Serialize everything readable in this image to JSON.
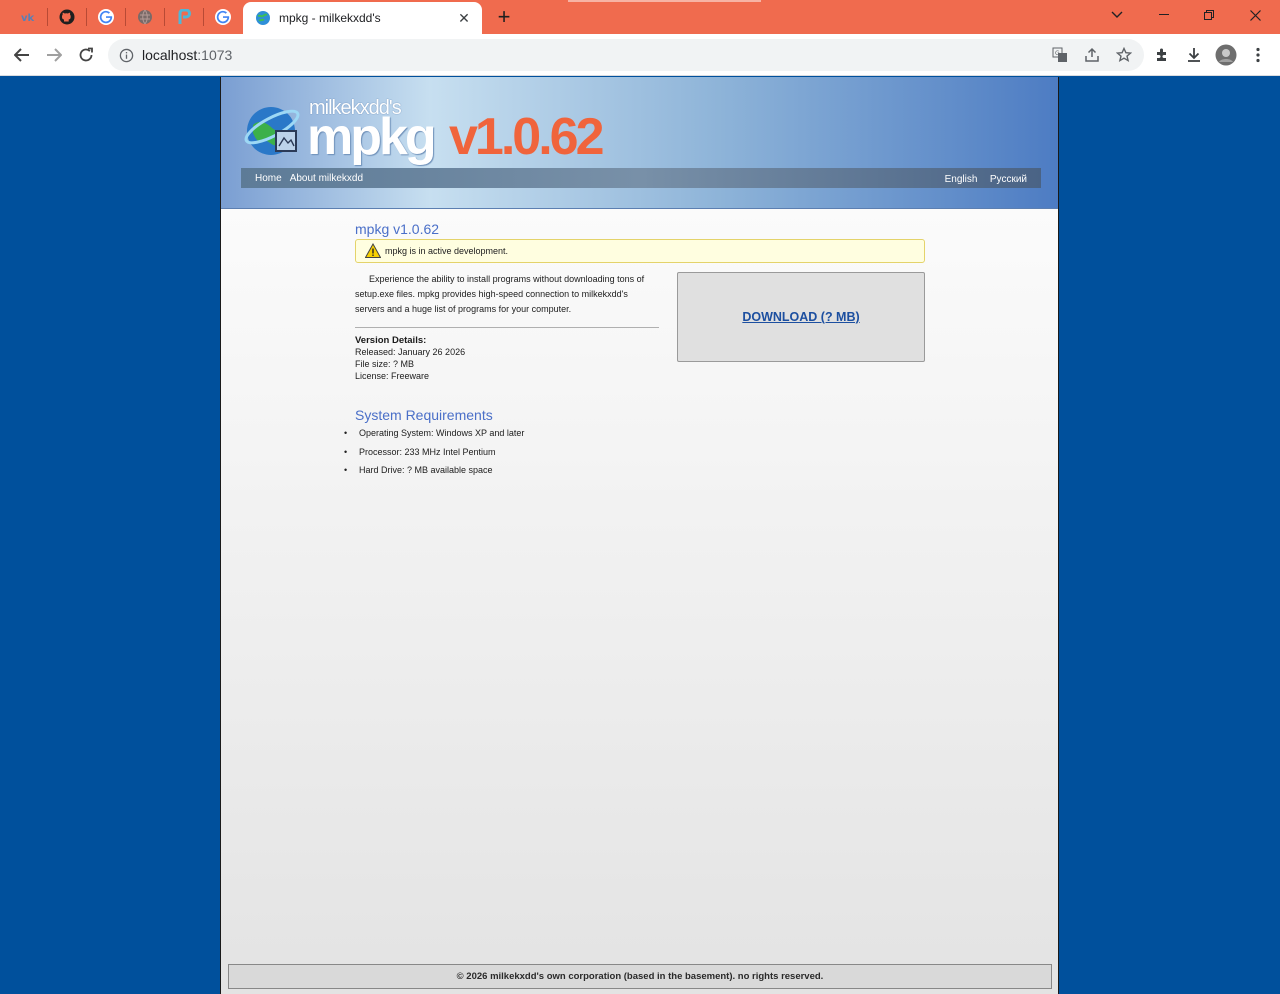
{
  "browser": {
    "pinned_tabs": [
      {
        "name": "vk-tab",
        "icon": "vk-icon"
      },
      {
        "name": "github-tab",
        "icon": "github-icon"
      },
      {
        "name": "google-tab-1",
        "icon": "google-icon"
      },
      {
        "name": "globe-tab",
        "icon": "globe-icon"
      },
      {
        "name": "app-tab",
        "icon": "p-app-icon"
      },
      {
        "name": "google-tab-2",
        "icon": "google-icon"
      }
    ],
    "active_tab_title": "mpkg - milkekxdd's",
    "address": {
      "host": "localhost",
      "port": ":1073"
    },
    "colors": {
      "tabbar": "#f06b4e",
      "page_bg": "#00509c"
    }
  },
  "site": {
    "brand_small": "milkekxdd's",
    "brand_big": "mpkg",
    "brand_version": "v1.0.62",
    "nav": {
      "home": "Home",
      "about": "About milkekxdd",
      "english": "English",
      "russian": "Русский"
    },
    "page_title": "mpkg v1.0.62",
    "notice": "mpkg is in active development.",
    "description": "Experience the ability to install programs without downloading tons of setup.exe files. mpkg provides high-speed connection to milkekxdd's servers and a huge list of programs for your computer.",
    "version_details": {
      "title": "Version Details:",
      "released": "Released: January 26 2026",
      "file_size": "File size: ? MB",
      "license": "License: Freeware"
    },
    "download_label": "DOWNLOAD (? MB)",
    "sysreq": {
      "title": "System Requirements",
      "os": "Operating System: Windows XP and later",
      "processor": "Processor: 233 MHz Intel Pentium",
      "hdd": "Hard Drive: ? MB available space"
    },
    "footer": "© 2026 milkekxdd's own corporation (based in the basement). no rights reserved."
  }
}
